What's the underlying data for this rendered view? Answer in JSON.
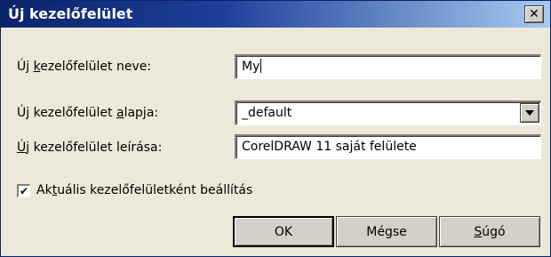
{
  "window": {
    "title": "Új kezelőfelület",
    "close_glyph": "✕"
  },
  "fields": {
    "name_label_pre": "Új ",
    "name_label_accel": "k",
    "name_label_post": "ezelőfelület neve:",
    "name_value": "My",
    "base_label_pre": "Új kezelőfelület ",
    "base_label_accel": "a",
    "base_label_post": "lapja:",
    "base_value": "_default",
    "desc_label_accel": "Ú",
    "desc_label_post": "j kezelőfelület leírása:",
    "desc_value": "CorelDRAW 11 saját felülete"
  },
  "checkbox": {
    "checked": true,
    "label_pre": "Ak",
    "label_accel": "t",
    "label_post": "uális kezelőfelületként beállítás"
  },
  "buttons": {
    "ok": "OK",
    "cancel": "Mégse",
    "help_accel": "S",
    "help_post": "úgó"
  }
}
